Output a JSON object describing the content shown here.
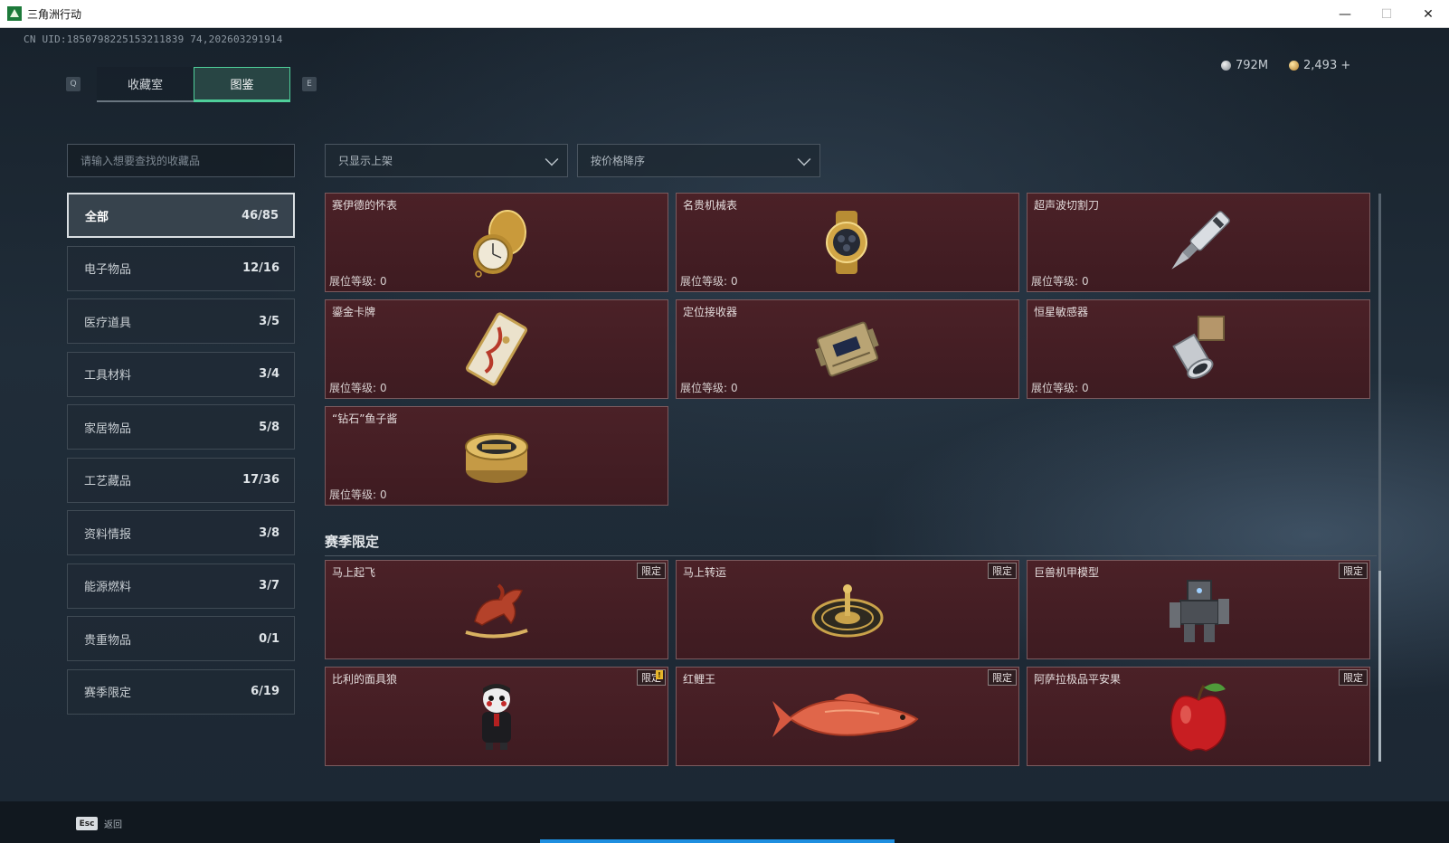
{
  "window": {
    "title": "三角洲行动",
    "minimize": "—",
    "maximize": "☐",
    "close": "✕"
  },
  "uid": "CN UID:1850798225153211839 74,202603291914",
  "tabs": {
    "left_key": "Q",
    "right_key": "E",
    "items": [
      {
        "label": "收藏室"
      },
      {
        "label": "图鉴"
      }
    ]
  },
  "currency": {
    "silver": "792M",
    "gold": "2,493 +"
  },
  "search": {
    "placeholder": "请输入想要查找的收藏品"
  },
  "categories": [
    {
      "label": "全部",
      "count": "46/85"
    },
    {
      "label": "电子物品",
      "count": "12/16"
    },
    {
      "label": "医疗道具",
      "count": "3/5"
    },
    {
      "label": "工具材料",
      "count": "3/4"
    },
    {
      "label": "家居物品",
      "count": "5/8"
    },
    {
      "label": "工艺藏品",
      "count": "17/36"
    },
    {
      "label": "资料情报",
      "count": "3/8"
    },
    {
      "label": "能源燃料",
      "count": "3/7"
    },
    {
      "label": "贵重物品",
      "count": "0/1"
    },
    {
      "label": "赛季限定",
      "count": "6/19"
    }
  ],
  "filters": {
    "shelf": "只显示上架",
    "sort": "按价格降序"
  },
  "level_label": "展位等级:",
  "items": [
    {
      "name": "赛伊德的怀表",
      "level": "0"
    },
    {
      "name": "名贵机械表",
      "level": "0"
    },
    {
      "name": "超声波切割刀",
      "level": "0"
    },
    {
      "name": "鎏金卡牌",
      "level": "0"
    },
    {
      "name": "定位接收器",
      "level": "0"
    },
    {
      "name": "恒星敏感器",
      "level": "0"
    },
    {
      "name": "“钻石”鱼子酱",
      "level": "0"
    }
  ],
  "season": {
    "title": "赛季限定",
    "tag": "限定",
    "items": [
      {
        "name": "马上起飞"
      },
      {
        "name": "马上转运"
      },
      {
        "name": "巨兽机甲模型"
      },
      {
        "name": "比利的面具狼"
      },
      {
        "name": "红鲤王"
      },
      {
        "name": "阿萨拉极品平安果"
      }
    ]
  },
  "footer": {
    "esc_key": "Esc",
    "back_label": "返回"
  }
}
